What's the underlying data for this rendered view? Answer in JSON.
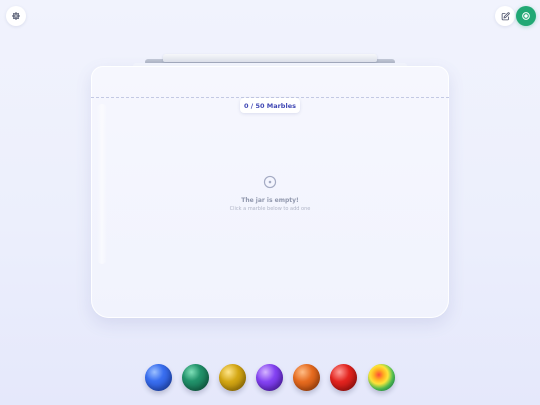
{
  "toolbar": {
    "settings_icon": "gear-icon",
    "edit_icon": "edit-icon",
    "action_icon": "target-icon",
    "action_color": "#21a874"
  },
  "jar": {
    "counter_text": "0 / 50 Marbles",
    "marble_count": 0,
    "capacity": 50,
    "empty_icon": "circle-dot-icon",
    "empty_title": "The jar is empty!",
    "empty_subtitle": "Click a marble below to add one"
  },
  "marbles": [
    {
      "color_name": "blue",
      "color": "#2f5fe0"
    },
    {
      "color_name": "green",
      "color": "#1c8a64"
    },
    {
      "color_name": "yellow",
      "color": "#d3a614"
    },
    {
      "color_name": "purple",
      "color": "#7b3df0"
    },
    {
      "color_name": "orange",
      "color": "#e2671d"
    },
    {
      "color_name": "red",
      "color": "#e0221f"
    },
    {
      "color_name": "rainbow",
      "color": "#4fd36a"
    }
  ]
}
